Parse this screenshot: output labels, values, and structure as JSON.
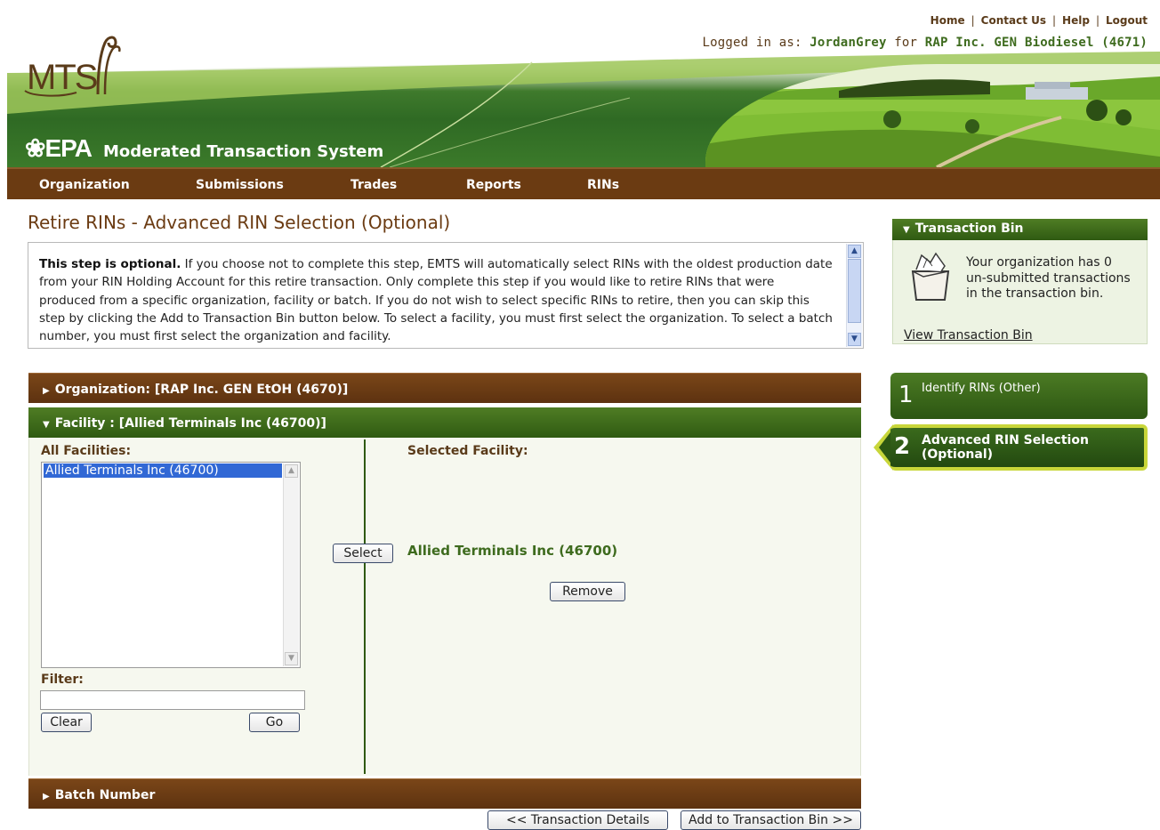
{
  "header": {
    "links": [
      "Home",
      "Contact Us",
      "Help",
      "Logout"
    ],
    "login_prefix": "Logged in as:",
    "username": "JordanGrey",
    "for_word": "for",
    "organization": "RAP Inc. GEN Biodiesel (4671)",
    "logo_text": "MTS",
    "epa_text": "EPA",
    "system_name": "Moderated Transaction System"
  },
  "nav": {
    "items": [
      "Organization",
      "Submissions",
      "Trades",
      "Reports",
      "RINs"
    ]
  },
  "page": {
    "title": "Retire RINs - Advanced RIN Selection (Optional)",
    "intro_bold": "This step is optional.",
    "intro_rest": " If you choose not to complete this step, EMTS will automatically select RINs with the oldest production date from your RIN Holding Account for this retire transaction. Only complete this step if you would like to retire RINs that were produced from a specific organization, facility or batch. If you do not wish to select specific RINs to retire, then you can skip this step by clicking the Add to Transaction Bin button below. To select a facility, you must first select the organization. To select a batch number, you must first select the organization and facility."
  },
  "panels": {
    "organization_label": "Organization: [RAP Inc. GEN EtOH (4670)]",
    "facility_label": "Facility : [Allied Terminals Inc (46700)]",
    "batch_label": "Batch Number"
  },
  "facility": {
    "all_label": "All Facilities:",
    "options": [
      "Allied Terminals Inc (46700)"
    ],
    "filter_label": "Filter:",
    "filter_value": "",
    "clear_button": "Clear",
    "go_button": "Go",
    "select_button": "Select",
    "selected_label": "Selected Facility:",
    "selected_value": "Allied Terminals Inc (46700)",
    "remove_button": "Remove"
  },
  "footer": {
    "back_button": "<< Transaction Details",
    "add_button": "Add to Transaction Bin >>"
  },
  "sidebar": {
    "bin_title": "Transaction Bin",
    "bin_text": "Your organization has 0 un-submitted transactions in the transaction bin.",
    "bin_link": "View Transaction Bin",
    "steps": [
      {
        "number": "1",
        "label": "Identify RINs (Other)"
      },
      {
        "number": "2",
        "label": "Advanced RIN Selection (Optional)"
      }
    ]
  },
  "colors": {
    "brown": "#6b3b12",
    "green": "#3e6b1e",
    "highlight": "#c8d63a"
  }
}
